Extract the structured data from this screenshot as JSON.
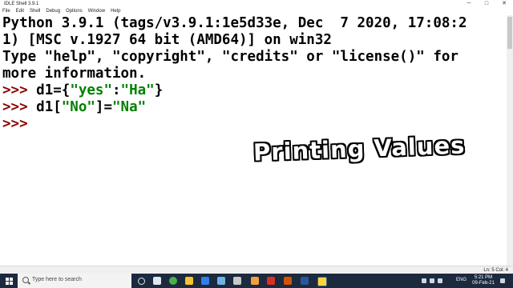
{
  "window": {
    "title": "IDLE Shell 3.9.1",
    "controls": {
      "minimize": "─",
      "maximize": "□",
      "close": "✕"
    }
  },
  "menu": [
    "File",
    "Edit",
    "Shell",
    "Debug",
    "Options",
    "Window",
    "Help"
  ],
  "shell": {
    "banner_line1": "Python 3.9.1 (tags/v3.9.1:1e5d33e, Dec  7 2020, 17:08:2",
    "banner_line2": "1) [MSC v.1927 64 bit (AMD64)] on win32",
    "banner_line3": "Type \"help\", \"copyright\", \"credits\" or \"license()\" for",
    "banner_line4": "more information.",
    "prompt": ">>> ",
    "cmd1_a": "d1={",
    "cmd1_s1": "\"yes\"",
    "cmd1_b": ":",
    "cmd1_s2": "\"Ha\"",
    "cmd1_c": "}",
    "cmd2_a": "d1[",
    "cmd2_s1": "\"No\"",
    "cmd2_b": "]=",
    "cmd2_s2": "\"Na\"",
    "empty_prompt": ">>>"
  },
  "overlay_text": "Printing Values",
  "status": {
    "position": "Ln: 5   Col: 4"
  },
  "taskbar": {
    "search_placeholder": "Type here to search",
    "language": "ENG",
    "time": "5:21 PM",
    "date": "09-Feb-21",
    "background": "#1c2a3f"
  },
  "colors": {
    "prompt": "#8b0000",
    "string": "#008000",
    "text": "#000000"
  }
}
